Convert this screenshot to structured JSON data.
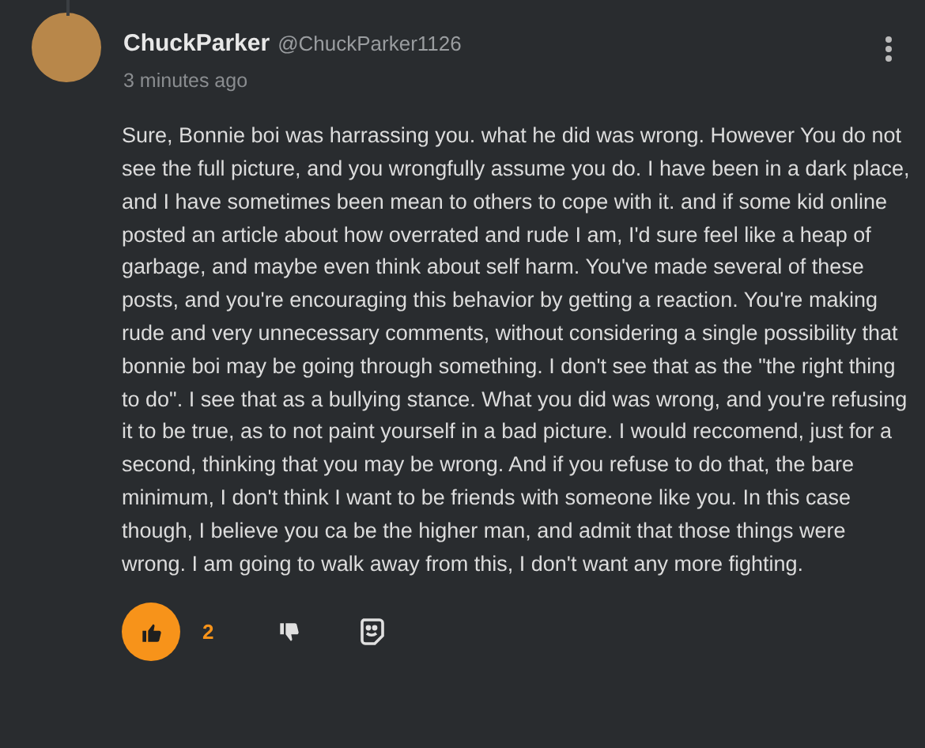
{
  "comment": {
    "author": "ChuckParker",
    "handle": "@ChuckParker1126",
    "time": "3 minutes ago",
    "body": "Sure, Bonnie boi was harrassing you. what he did was wrong. However You do not see the full picture, and you wrongfully assume you do. I have been in a dark place, and I have sometimes been mean to others to cope with it. and if some kid online posted an article about how overrated and rude I am, I'd sure feel like a heap of garbage, and maybe even think about self harm. You've made several of these posts, and you're encouraging this behavior by getting a reaction. You're making rude and very unnecessary comments, without considering a single possibility that bonnie boi may be going through something. I don't see that as the \"the right thing to do\". I see that as a bullying stance. What you did was wrong, and you're refusing it to be true, as to not paint yourself in a bad picture. I would reccomend, just for a second, thinking that you may be wrong. And if you refuse to do that, the bare minimum, I don't think I want to be friends with someone like you. In this case though, I believe you ca be the higher man, and admit that those things were wrong. I am going to walk away from this, I don't want any more fighting.",
    "like": {
      "selected": true,
      "count": "2"
    },
    "dislike": {
      "selected": false
    }
  }
}
